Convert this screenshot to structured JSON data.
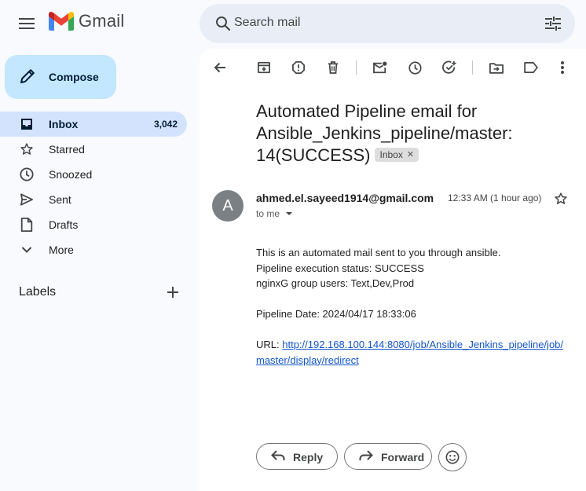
{
  "header": {
    "app_name": "Gmail",
    "search_placeholder": "Search mail"
  },
  "sidebar": {
    "compose_label": "Compose",
    "items": [
      {
        "label": "Inbox",
        "count": "3,042",
        "icon": "inbox-icon",
        "active": true
      },
      {
        "label": "Starred",
        "count": "",
        "icon": "star-icon",
        "active": false
      },
      {
        "label": "Snoozed",
        "count": "",
        "icon": "clock-icon",
        "active": false
      },
      {
        "label": "Sent",
        "count": "",
        "icon": "send-icon",
        "active": false
      },
      {
        "label": "Drafts",
        "count": "",
        "icon": "draft-icon",
        "active": false
      },
      {
        "label": "More",
        "count": "",
        "icon": "chevron-down-icon",
        "active": false
      }
    ],
    "labels_title": "Labels"
  },
  "toolbar": {
    "icons": [
      "back-icon",
      "archive-icon",
      "report-spam-icon",
      "delete-icon",
      "mark-unread-icon",
      "snooze-icon",
      "add-task-icon",
      "move-to-icon",
      "label-icon",
      "more-vert-icon"
    ]
  },
  "email": {
    "subject": "Automated Pipeline email for Ansible_Jenkins_pipeline/master: 14(SUCCESS)",
    "chip": "Inbox",
    "avatar_letter": "A",
    "sender": "ahmed.el.sayeed1914@gmail.com",
    "time": "12:33 AM (1 hour ago)",
    "to": "to me",
    "body": {
      "line1": "This is an automated mail sent to you through ansible.",
      "line2": "Pipeline execution status: SUCCESS",
      "line3": "nginxG group users: Text,Dev,Prod",
      "date_line": "Pipeline Date: 2024/04/17 18:33:06",
      "url_label": "URL: ",
      "url": "http://192.168.100.144:8080/job/Ansible_Jenkins_pipeline/job/master/display/redirect"
    }
  },
  "actions": {
    "reply": "Reply",
    "forward": "Forward"
  },
  "colors": {
    "background": "#f8fafd",
    "compose": "#c2e7ff",
    "active_nav": "#d3e3fd",
    "search": "#e9eef6",
    "link": "#1155cc"
  }
}
